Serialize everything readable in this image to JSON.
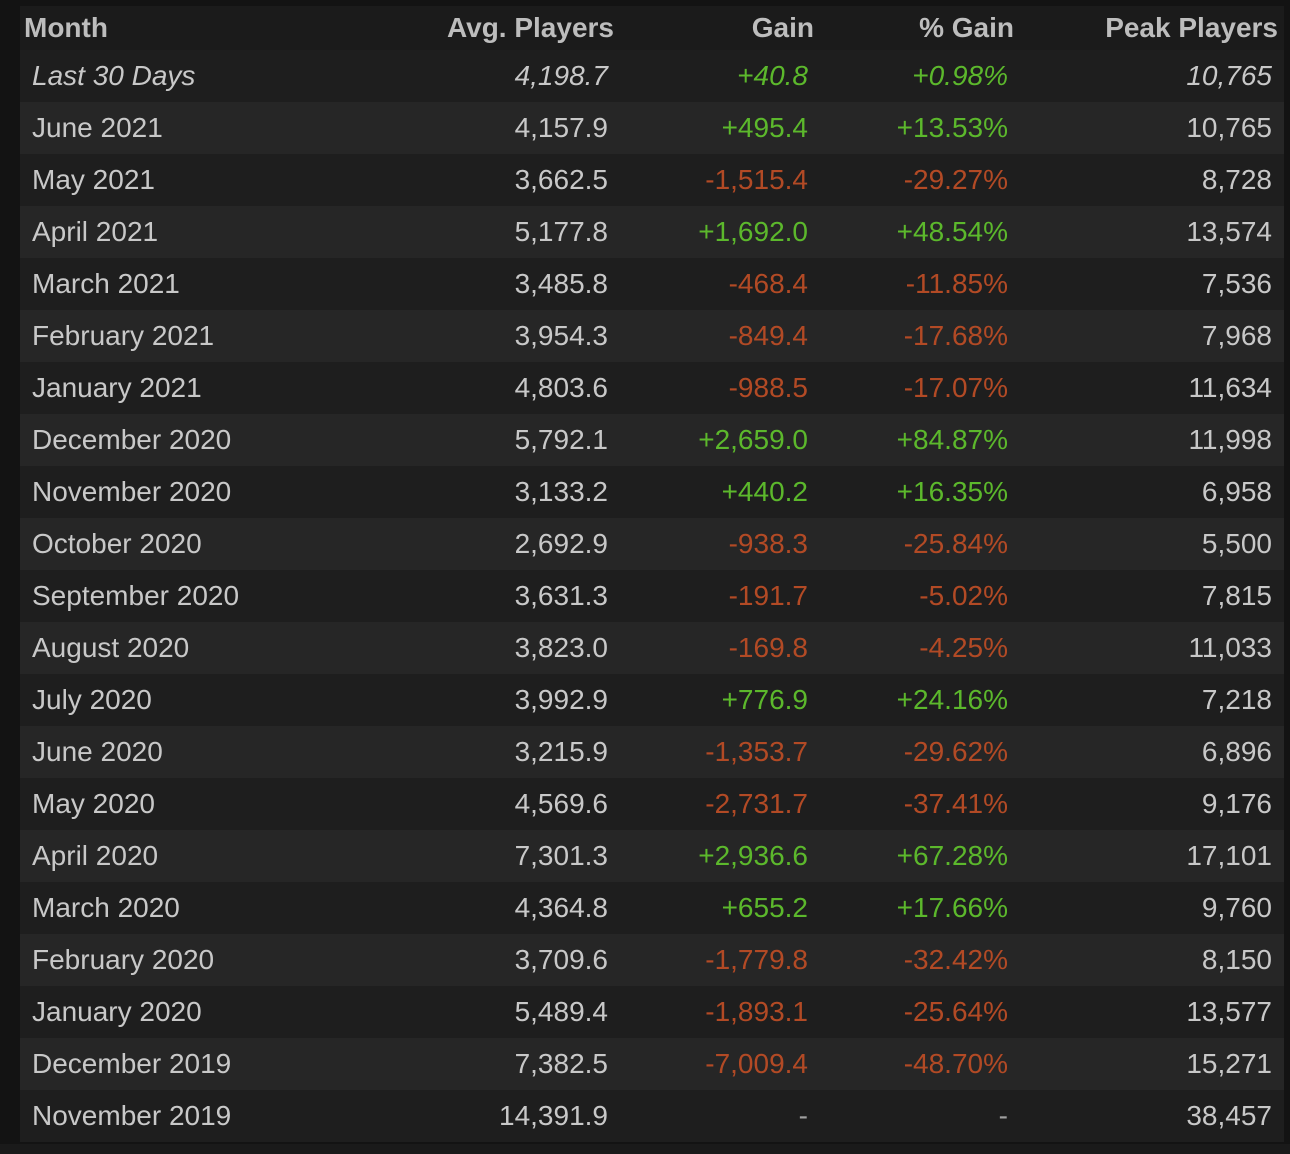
{
  "headers": {
    "month": "Month",
    "avg": "Avg. Players",
    "gain": "Gain",
    "pct": "% Gain",
    "peak": "Peak Players"
  },
  "colors": {
    "positive": "#5cb82c",
    "negative": "#b24a25",
    "text": "#c8c8c8",
    "background": "#131313"
  },
  "rows": [
    {
      "month": "Last 30 Days",
      "avg": "4,198.7",
      "gain": "+40.8",
      "pct": "+0.98%",
      "peak": "10,765",
      "trend": "pos"
    },
    {
      "month": "June 2021",
      "avg": "4,157.9",
      "gain": "+495.4",
      "pct": "+13.53%",
      "peak": "10,765",
      "trend": "pos"
    },
    {
      "month": "May 2021",
      "avg": "3,662.5",
      "gain": "-1,515.4",
      "pct": "-29.27%",
      "peak": "8,728",
      "trend": "neg"
    },
    {
      "month": "April 2021",
      "avg": "5,177.8",
      "gain": "+1,692.0",
      "pct": "+48.54%",
      "peak": "13,574",
      "trend": "pos"
    },
    {
      "month": "March 2021",
      "avg": "3,485.8",
      "gain": "-468.4",
      "pct": "-11.85%",
      "peak": "7,536",
      "trend": "neg"
    },
    {
      "month": "February 2021",
      "avg": "3,954.3",
      "gain": "-849.4",
      "pct": "-17.68%",
      "peak": "7,968",
      "trend": "neg"
    },
    {
      "month": "January 2021",
      "avg": "4,803.6",
      "gain": "-988.5",
      "pct": "-17.07%",
      "peak": "11,634",
      "trend": "neg"
    },
    {
      "month": "December 2020",
      "avg": "5,792.1",
      "gain": "+2,659.0",
      "pct": "+84.87%",
      "peak": "11,998",
      "trend": "pos"
    },
    {
      "month": "November 2020",
      "avg": "3,133.2",
      "gain": "+440.2",
      "pct": "+16.35%",
      "peak": "6,958",
      "trend": "pos"
    },
    {
      "month": "October 2020",
      "avg": "2,692.9",
      "gain": "-938.3",
      "pct": "-25.84%",
      "peak": "5,500",
      "trend": "neg"
    },
    {
      "month": "September 2020",
      "avg": "3,631.3",
      "gain": "-191.7",
      "pct": "-5.02%",
      "peak": "7,815",
      "trend": "neg"
    },
    {
      "month": "August 2020",
      "avg": "3,823.0",
      "gain": "-169.8",
      "pct": "-4.25%",
      "peak": "11,033",
      "trend": "neg"
    },
    {
      "month": "July 2020",
      "avg": "3,992.9",
      "gain": "+776.9",
      "pct": "+24.16%",
      "peak": "7,218",
      "trend": "pos"
    },
    {
      "month": "June 2020",
      "avg": "3,215.9",
      "gain": "-1,353.7",
      "pct": "-29.62%",
      "peak": "6,896",
      "trend": "neg"
    },
    {
      "month": "May 2020",
      "avg": "4,569.6",
      "gain": "-2,731.7",
      "pct": "-37.41%",
      "peak": "9,176",
      "trend": "neg"
    },
    {
      "month": "April 2020",
      "avg": "7,301.3",
      "gain": "+2,936.6",
      "pct": "+67.28%",
      "peak": "17,101",
      "trend": "pos"
    },
    {
      "month": "March 2020",
      "avg": "4,364.8",
      "gain": "+655.2",
      "pct": "+17.66%",
      "peak": "9,760",
      "trend": "pos"
    },
    {
      "month": "February 2020",
      "avg": "3,709.6",
      "gain": "-1,779.8",
      "pct": "-32.42%",
      "peak": "8,150",
      "trend": "neg"
    },
    {
      "month": "January 2020",
      "avg": "5,489.4",
      "gain": "-1,893.1",
      "pct": "-25.64%",
      "peak": "13,577",
      "trend": "neg"
    },
    {
      "month": "December 2019",
      "avg": "7,382.5",
      "gain": "-7,009.4",
      "pct": "-48.70%",
      "peak": "15,271",
      "trend": "neg"
    },
    {
      "month": "November 2019",
      "avg": "14,391.9",
      "gain": "-",
      "pct": "-",
      "peak": "38,457",
      "trend": "neutral"
    }
  ]
}
